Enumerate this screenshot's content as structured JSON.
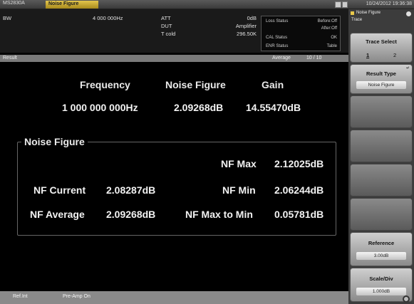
{
  "titlebar": {
    "app_name": "MS2830A",
    "active_tab": "Noise Figure",
    "datetime": "10/24/2012 19:36:38"
  },
  "top_info": {
    "bw_label": "BW",
    "bw_value": "4 000 000Hz",
    "rows": [
      {
        "label": "ATT",
        "value": "0dB"
      },
      {
        "label": "DUT",
        "value": "Amplifier"
      },
      {
        "label": "T cold",
        "value": "296.50K"
      }
    ],
    "status": {
      "loss_label": "Loss Status",
      "loss_before": "Before:Off",
      "loss_after": "After:Off",
      "cal_label": "CAL Status",
      "cal_value": "OK",
      "enr_label": "ENR Status",
      "enr_value": "Table"
    }
  },
  "result_bar": {
    "label": "Result",
    "mode": "Average",
    "count": "10 /  10"
  },
  "summary": {
    "headers": {
      "frequency": "Frequency",
      "noise_figure": "Noise Figure",
      "gain": "Gain"
    },
    "frequency": "1 000 000 000Hz",
    "noise_figure": "2.09268dB",
    "gain": "14.55470dB"
  },
  "nf_panel": {
    "title": "Noise Figure",
    "nf_max_label": "NF Max",
    "nf_max_value": "2.12025dB",
    "nf_current_label": "NF Current",
    "nf_current_value": "2.08287dB",
    "nf_min_label": "NF Min",
    "nf_min_value": "2.06244dB",
    "nf_average_label": "NF Average",
    "nf_average_value": "2.09268dB",
    "nf_max_to_min_label": "NF Max to Min",
    "nf_max_to_min_value": "0.05781dB"
  },
  "bottom_bar": {
    "ref": "Ref.Int",
    "preamp": "Pre-Amp On"
  },
  "softkeys": {
    "header_title": "Noise Figure",
    "header_sub": "Trace",
    "trace_select": {
      "title": "Trace Select",
      "options": [
        "1",
        "2"
      ],
      "selected": "1"
    },
    "result_type": {
      "title": "Result Type",
      "value": "Noise Figure"
    },
    "reference": {
      "title": "Reference",
      "value": "3.00dB"
    },
    "scale_div": {
      "title": "Scale/Div",
      "value": "1.000dB"
    }
  },
  "colors": {
    "tab_active": "#e3c64d",
    "background": "#000000",
    "text": "#f2f2f2",
    "softkey": "#cfcfcf"
  }
}
